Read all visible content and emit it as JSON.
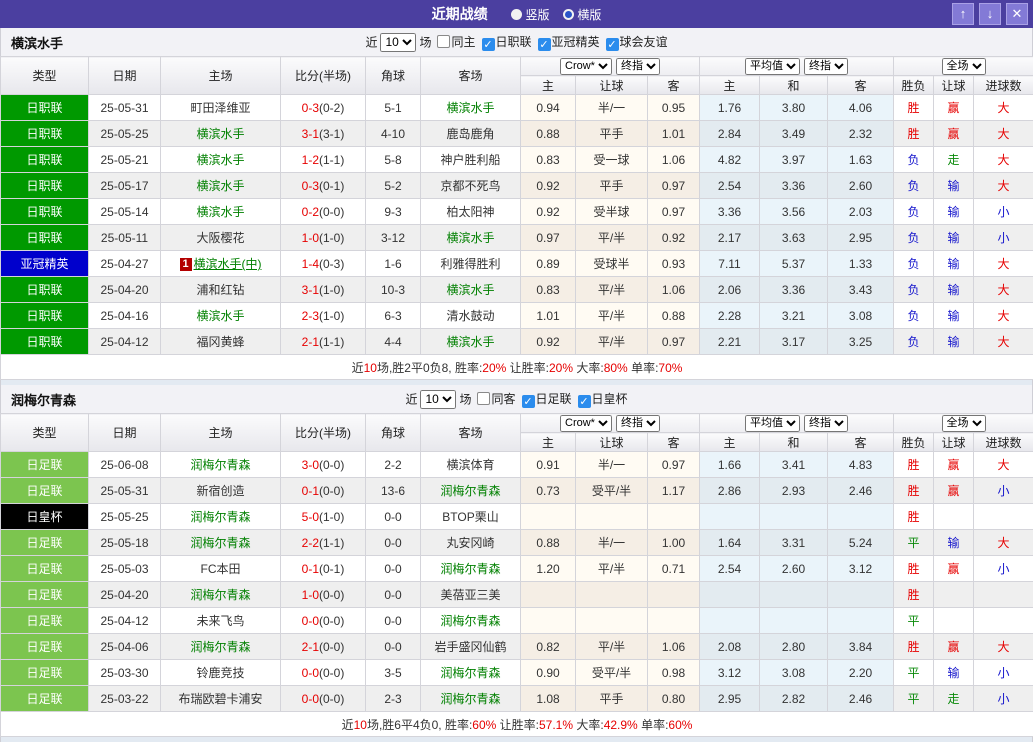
{
  "titlebar": {
    "title": "近期战绩",
    "radio_vertical": "竖版",
    "radio_horizontal": "横版",
    "selected": "横版",
    "buttons": {
      "up": "↑",
      "down": "↓",
      "close": "✕"
    }
  },
  "columns": [
    "类型",
    "日期",
    "主场",
    "比分(半场)",
    "角球",
    "客场"
  ],
  "subcolumns": [
    "主",
    "让球",
    "客",
    "主",
    "和",
    "客",
    "胜负",
    "让球",
    "进球数"
  ],
  "selects": {
    "odds_source": "Crow*",
    "odds_stage": "终指",
    "avg_label": "平均值",
    "avg_stage": "终指",
    "scope": "全场"
  },
  "filter_words": {
    "prefix": "近",
    "suffix": "场"
  },
  "type_styles": {
    "日职联": "#009900",
    "亚冠精英": "#0000cc",
    "日足联": "#7cc54f",
    "日皇杯": "#000000"
  },
  "sections": [
    {
      "team": "横滨水手",
      "filter": {
        "matches": "10",
        "same_label": "同主",
        "same_checked": false,
        "leagues": [
          {
            "label": "日职联",
            "checked": true
          },
          {
            "label": "亚冠精英",
            "checked": true
          },
          {
            "label": "球会友谊",
            "checked": true
          }
        ]
      },
      "rows": [
        {
          "type": "日职联",
          "date": "25-05-31",
          "home": "町田泽维亚",
          "home_green": false,
          "score": "0-3",
          "half": "(0-2)",
          "corner": "5-1",
          "away": "横滨水手",
          "away_green": true,
          "crow": [
            "0.94",
            "半/一",
            "0.95"
          ],
          "avg": [
            "1.76",
            "3.80",
            "4.06"
          ],
          "res": [
            "胜",
            "赢",
            "大"
          ]
        },
        {
          "type": "日职联",
          "date": "25-05-25",
          "home": "横滨水手",
          "home_green": true,
          "score": "3-1",
          "half": "(3-1)",
          "corner": "4-10",
          "away": "鹿岛鹿角",
          "away_green": false,
          "crow": [
            "0.88",
            "平手",
            "1.01"
          ],
          "avg": [
            "2.84",
            "3.49",
            "2.32"
          ],
          "res": [
            "胜",
            "赢",
            "大"
          ]
        },
        {
          "type": "日职联",
          "date": "25-05-21",
          "home": "横滨水手",
          "home_green": true,
          "score": "1-2",
          "half": "(1-1)",
          "corner": "5-8",
          "away": "神户胜利船",
          "away_green": false,
          "crow": [
            "0.83",
            "受一球",
            "1.06"
          ],
          "avg": [
            "4.82",
            "3.97",
            "1.63"
          ],
          "res": [
            "负",
            "走",
            "大"
          ]
        },
        {
          "type": "日职联",
          "date": "25-05-17",
          "home": "横滨水手",
          "home_green": true,
          "score": "0-3",
          "half": "(0-1)",
          "corner": "5-2",
          "away": "京都不死鸟",
          "away_green": false,
          "crow": [
            "0.92",
            "平手",
            "0.97"
          ],
          "avg": [
            "2.54",
            "3.36",
            "2.60"
          ],
          "res": [
            "负",
            "输",
            "大"
          ]
        },
        {
          "type": "日职联",
          "date": "25-05-14",
          "home": "横滨水手",
          "home_green": true,
          "score": "0-2",
          "half": "(0-0)",
          "corner": "9-3",
          "away": "柏太阳神",
          "away_green": false,
          "crow": [
            "0.92",
            "受半球",
            "0.97"
          ],
          "avg": [
            "3.36",
            "3.56",
            "2.03"
          ],
          "res": [
            "负",
            "输",
            "小"
          ]
        },
        {
          "type": "日职联",
          "date": "25-05-11",
          "home": "大阪樱花",
          "home_green": false,
          "score": "1-0",
          "half": "(1-0)",
          "corner": "3-12",
          "away": "横滨水手",
          "away_green": true,
          "crow": [
            "0.97",
            "平/半",
            "0.92"
          ],
          "avg": [
            "2.17",
            "3.63",
            "2.95"
          ],
          "res": [
            "负",
            "输",
            "小"
          ]
        },
        {
          "type": "亚冠精英",
          "date": "25-04-27",
          "home": "横滨水手(中)",
          "home_green": true,
          "home_badge": "1",
          "home_underline": true,
          "score": "1-4",
          "half": "(0-3)",
          "corner": "1-6",
          "away": "利雅得胜利",
          "away_green": false,
          "crow": [
            "0.89",
            "受球半",
            "0.93"
          ],
          "avg": [
            "7.11",
            "5.37",
            "1.33"
          ],
          "res": [
            "负",
            "输",
            "大"
          ]
        },
        {
          "type": "日职联",
          "date": "25-04-20",
          "home": "浦和红钻",
          "home_green": false,
          "score": "3-1",
          "half": "(1-0)",
          "corner": "10-3",
          "away": "横滨水手",
          "away_green": true,
          "crow": [
            "0.83",
            "平/半",
            "1.06"
          ],
          "avg": [
            "2.06",
            "3.36",
            "3.43"
          ],
          "res": [
            "负",
            "输",
            "大"
          ]
        },
        {
          "type": "日职联",
          "date": "25-04-16",
          "home": "横滨水手",
          "home_green": true,
          "score": "2-3",
          "half": "(1-0)",
          "corner": "6-3",
          "away": "清水鼓动",
          "away_green": false,
          "crow": [
            "1.01",
            "平/半",
            "0.88"
          ],
          "avg": [
            "2.28",
            "3.21",
            "3.08"
          ],
          "res": [
            "负",
            "输",
            "大"
          ]
        },
        {
          "type": "日职联",
          "date": "25-04-12",
          "home": "福冈黄蜂",
          "home_green": false,
          "score": "2-1",
          "half": "(1-1)",
          "corner": "4-4",
          "away": "横滨水手",
          "away_green": true,
          "crow": [
            "0.92",
            "平/半",
            "0.97"
          ],
          "avg": [
            "2.21",
            "3.17",
            "3.25"
          ],
          "res": [
            "负",
            "输",
            "大"
          ]
        }
      ],
      "summary": [
        {
          "t": "近"
        },
        {
          "t": "10",
          "red": true
        },
        {
          "t": "场,胜2平0负8, 胜率:"
        },
        {
          "t": "20%",
          "red": true
        },
        {
          "t": " 让胜率:"
        },
        {
          "t": "20%",
          "red": true
        },
        {
          "t": " 大率:"
        },
        {
          "t": "80%",
          "red": true
        },
        {
          "t": " 单率:"
        },
        {
          "t": "70%",
          "red": true
        }
      ]
    },
    {
      "team": "润梅尔青森",
      "filter": {
        "matches": "10",
        "same_label": "同客",
        "same_checked": false,
        "leagues": [
          {
            "label": "日足联",
            "checked": true
          },
          {
            "label": "日皇杯",
            "checked": true
          }
        ]
      },
      "rows": [
        {
          "type": "日足联",
          "date": "25-06-08",
          "home": "润梅尔青森",
          "home_green": true,
          "score": "3-0",
          "half": "(0-0)",
          "corner": "2-2",
          "away": "横滨体育",
          "away_green": false,
          "crow": [
            "0.91",
            "半/一",
            "0.97"
          ],
          "avg": [
            "1.66",
            "3.41",
            "4.83"
          ],
          "res": [
            "胜",
            "赢",
            "大"
          ]
        },
        {
          "type": "日足联",
          "date": "25-05-31",
          "home": "新宿创造",
          "home_green": false,
          "score": "0-1",
          "half": "(0-0)",
          "corner": "13-6",
          "away": "润梅尔青森",
          "away_green": true,
          "crow": [
            "0.73",
            "受平/半",
            "1.17"
          ],
          "avg": [
            "2.86",
            "2.93",
            "2.46"
          ],
          "res": [
            "胜",
            "赢",
            "小"
          ]
        },
        {
          "type": "日皇杯",
          "date": "25-05-25",
          "home": "润梅尔青森",
          "home_green": true,
          "score": "5-0",
          "half": "(1-0)",
          "corner": "0-0",
          "away": "BTOP栗山",
          "away_green": false,
          "crow": [
            "",
            "",
            ""
          ],
          "avg": [
            "",
            "",
            ""
          ],
          "res": [
            "胜",
            "",
            ""
          ]
        },
        {
          "type": "日足联",
          "date": "25-05-18",
          "home": "润梅尔青森",
          "home_green": true,
          "score": "2-2",
          "half": "(1-1)",
          "corner": "0-0",
          "away": "丸安冈崎",
          "away_green": false,
          "crow": [
            "0.88",
            "半/一",
            "1.00"
          ],
          "avg": [
            "1.64",
            "3.31",
            "5.24"
          ],
          "res": [
            "平",
            "输",
            "大"
          ]
        },
        {
          "type": "日足联",
          "date": "25-05-03",
          "home": "FC本田",
          "home_green": false,
          "score": "0-1",
          "half": "(0-1)",
          "corner": "0-0",
          "away": "润梅尔青森",
          "away_green": true,
          "crow": [
            "1.20",
            "平/半",
            "0.71"
          ],
          "avg": [
            "2.54",
            "2.60",
            "3.12"
          ],
          "res": [
            "胜",
            "赢",
            "小"
          ]
        },
        {
          "type": "日足联",
          "date": "25-04-20",
          "home": "润梅尔青森",
          "home_green": true,
          "score": "1-0",
          "half": "(0-0)",
          "corner": "0-0",
          "away": "美蓓亚三美",
          "away_green": false,
          "crow": [
            "",
            "",
            ""
          ],
          "avg": [
            "",
            "",
            ""
          ],
          "res": [
            "胜",
            "",
            ""
          ]
        },
        {
          "type": "日足联",
          "date": "25-04-12",
          "home": "未来飞鸟",
          "home_green": false,
          "score": "0-0",
          "half": "(0-0)",
          "corner": "0-0",
          "away": "润梅尔青森",
          "away_green": true,
          "crow": [
            "",
            "",
            ""
          ],
          "avg": [
            "",
            "",
            ""
          ],
          "res": [
            "平",
            "",
            ""
          ]
        },
        {
          "type": "日足联",
          "date": "25-04-06",
          "home": "润梅尔青森",
          "home_green": true,
          "score": "2-1",
          "half": "(0-0)",
          "corner": "0-0",
          "away": "岩手盛冈仙鹤",
          "away_green": false,
          "crow": [
            "0.82",
            "平/半",
            "1.06"
          ],
          "avg": [
            "2.08",
            "2.80",
            "3.84"
          ],
          "res": [
            "胜",
            "赢",
            "大"
          ]
        },
        {
          "type": "日足联",
          "date": "25-03-30",
          "home": "铃鹿竞技",
          "home_green": false,
          "score": "0-0",
          "half": "(0-0)",
          "corner": "3-5",
          "away": "润梅尔青森",
          "away_green": true,
          "crow": [
            "0.90",
            "受平/半",
            "0.98"
          ],
          "avg": [
            "3.12",
            "3.08",
            "2.20"
          ],
          "res": [
            "平",
            "输",
            "小"
          ]
        },
        {
          "type": "日足联",
          "date": "25-03-22",
          "home": "布瑞欧碧卡浦安",
          "home_green": false,
          "score": "0-0",
          "half": "(0-0)",
          "corner": "2-3",
          "away": "润梅尔青森",
          "away_green": true,
          "crow": [
            "1.08",
            "平手",
            "0.80"
          ],
          "avg": [
            "2.95",
            "2.82",
            "2.46"
          ],
          "res": [
            "平",
            "走",
            "小"
          ]
        }
      ],
      "summary": [
        {
          "t": "近"
        },
        {
          "t": "10",
          "red": true
        },
        {
          "t": "场,胜6平4负0, 胜率:"
        },
        {
          "t": "60%",
          "red": true
        },
        {
          "t": " 让胜率:"
        },
        {
          "t": "57.1%",
          "red": true
        },
        {
          "t": " 大率:"
        },
        {
          "t": "42.9%",
          "red": true
        },
        {
          "t": " 单率:"
        },
        {
          "t": "60%",
          "red": true
        }
      ]
    }
  ]
}
